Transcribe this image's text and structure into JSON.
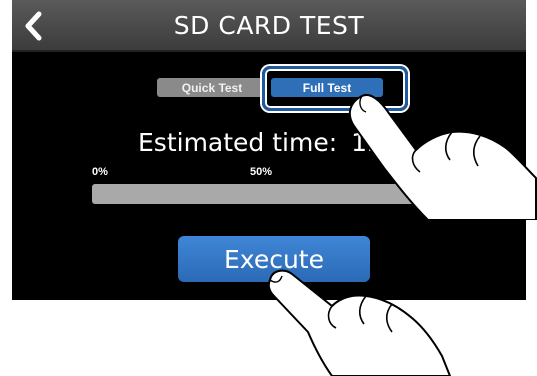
{
  "header": {
    "title": "SD CARD TEST",
    "back_icon": "chevron-left-icon"
  },
  "test_mode": {
    "options": [
      "Quick Test",
      "Full Test"
    ],
    "selected": "Full Test"
  },
  "estimate": {
    "label": "Estimated time:",
    "value": "1h..."
  },
  "progress": {
    "tick_start": "0%",
    "tick_mid": "50%",
    "fraction": 0
  },
  "execute": {
    "label": "Execute"
  },
  "colors": {
    "accent": "#2f6fb8",
    "header_bg": "#4a4a4a",
    "screen_bg": "#000000",
    "inactive_segment": "#8a8a8a",
    "track": "#a9a9a9"
  }
}
